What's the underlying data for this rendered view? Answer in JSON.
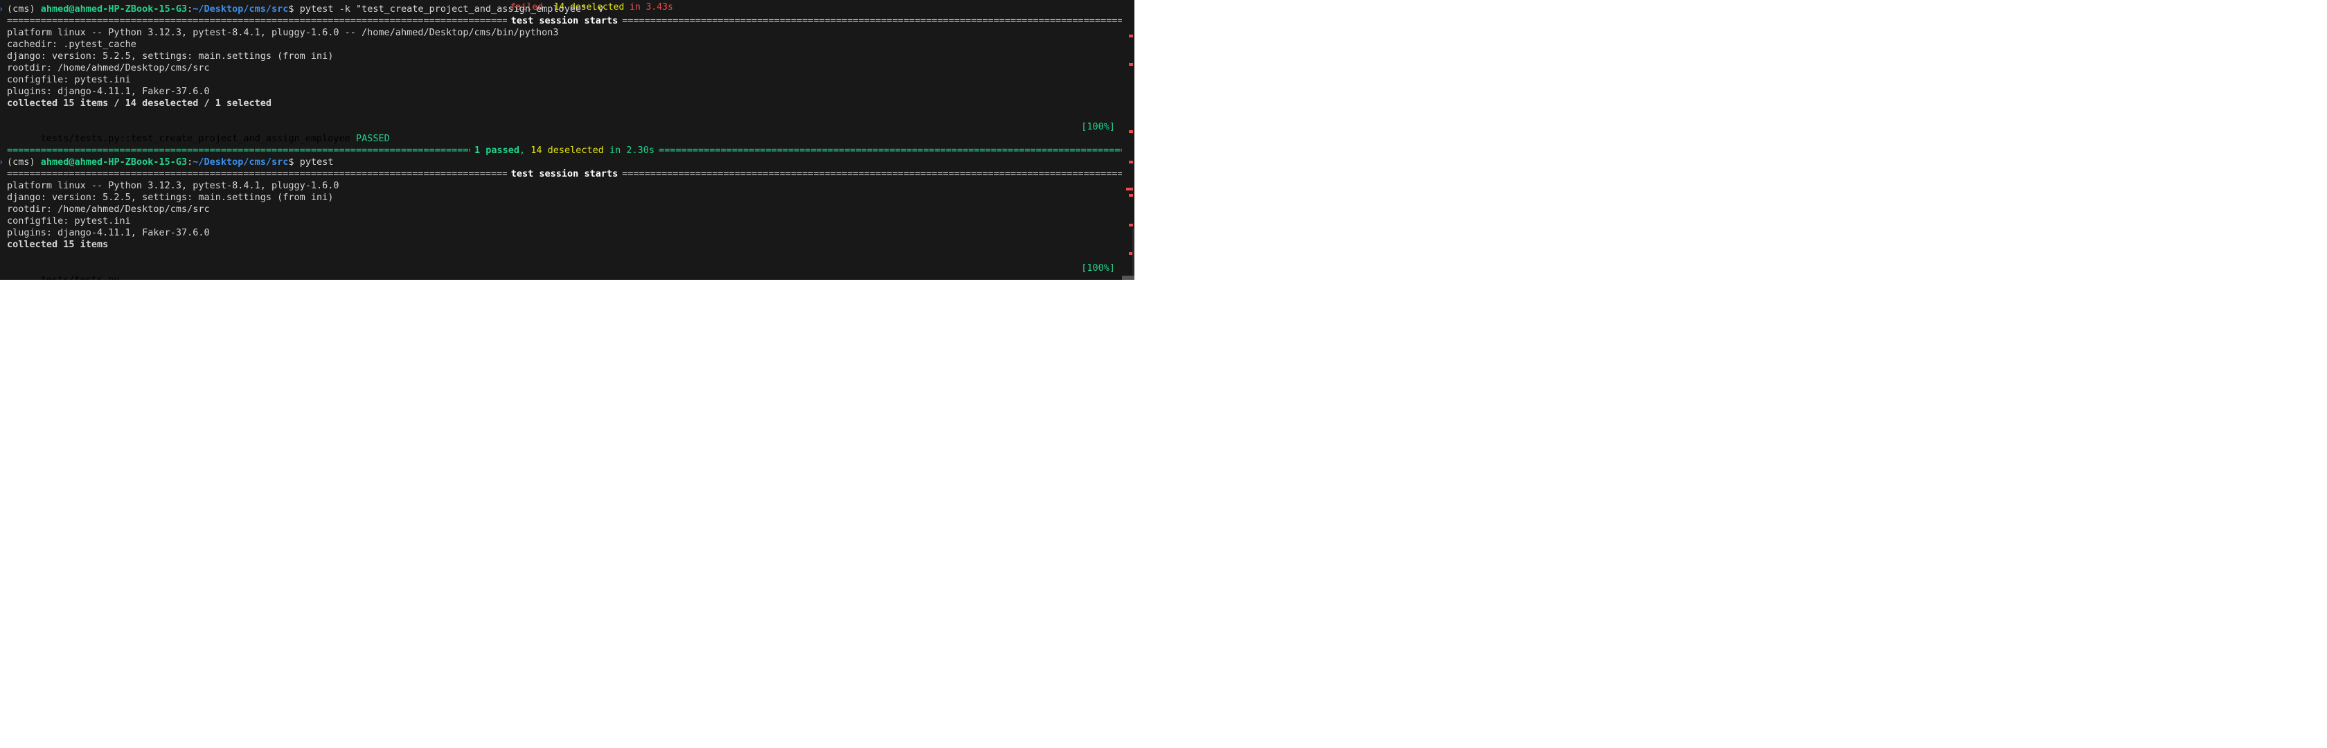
{
  "top_partial": {
    "failed": "failed",
    "sep": ", ",
    "deselected": "14 deselected",
    "time": " in 3.43s"
  },
  "session1": {
    "prompt_env": "(cms) ",
    "prompt_user": "ahmed@ahmed-HP-ZBook-15-G3",
    "prompt_colon": ":",
    "prompt_path": "~/Desktop/cms/src",
    "prompt_dollar": "$ ",
    "command": "pytest -k \"test_create_project_and_assign_employee\" -v",
    "header": "test session starts",
    "lines": [
      "platform linux -- Python 3.12.3, pytest-8.4.1, pluggy-1.6.0 -- /home/ahmed/Desktop/cms/bin/python3",
      "cachedir: .pytest_cache",
      "django: version: 5.2.5, settings: main.settings (from ini)",
      "rootdir: /home/ahmed/Desktop/cms/src",
      "configfile: pytest.ini",
      "plugins: django-4.11.1, Faker-37.6.0"
    ],
    "collected": "collected 15 items / 14 deselected / 1 selected",
    "test_name": "tests/tests.py::test_create_project_and_assign_employee ",
    "test_status": "PASSED",
    "test_pct": "[100%]",
    "summary_passed": "1 passed",
    "summary_sep": ", ",
    "summary_deselected": "14 deselected",
    "summary_time": " in 2.30s"
  },
  "session2": {
    "prompt_env": "(cms) ",
    "prompt_user": "ahmed@ahmed-HP-ZBook-15-G3",
    "prompt_colon": ":",
    "prompt_path": "~/Desktop/cms/src",
    "prompt_dollar": "$ ",
    "command": "pytest",
    "header": "test session starts",
    "lines": [
      "platform linux -- Python 3.12.3, pytest-8.4.1, pluggy-1.6.0",
      "django: version: 5.2.5, settings: main.settings (from ini)",
      "rootdir: /home/ahmed/Desktop/cms/src",
      "configfile: pytest.ini",
      "plugins: django-4.11.1, Faker-37.6.0"
    ],
    "collected": "collected 15 items",
    "test_file": "tests/tests.py ",
    "test_dots": "...............",
    "test_pct": "[100%]"
  },
  "colors": {
    "background": "#181818",
    "text": "#d6d6d6",
    "green": "#23d18b",
    "blue": "#3b8eea",
    "yellow": "#e5e510",
    "red": "#f14c4c"
  }
}
